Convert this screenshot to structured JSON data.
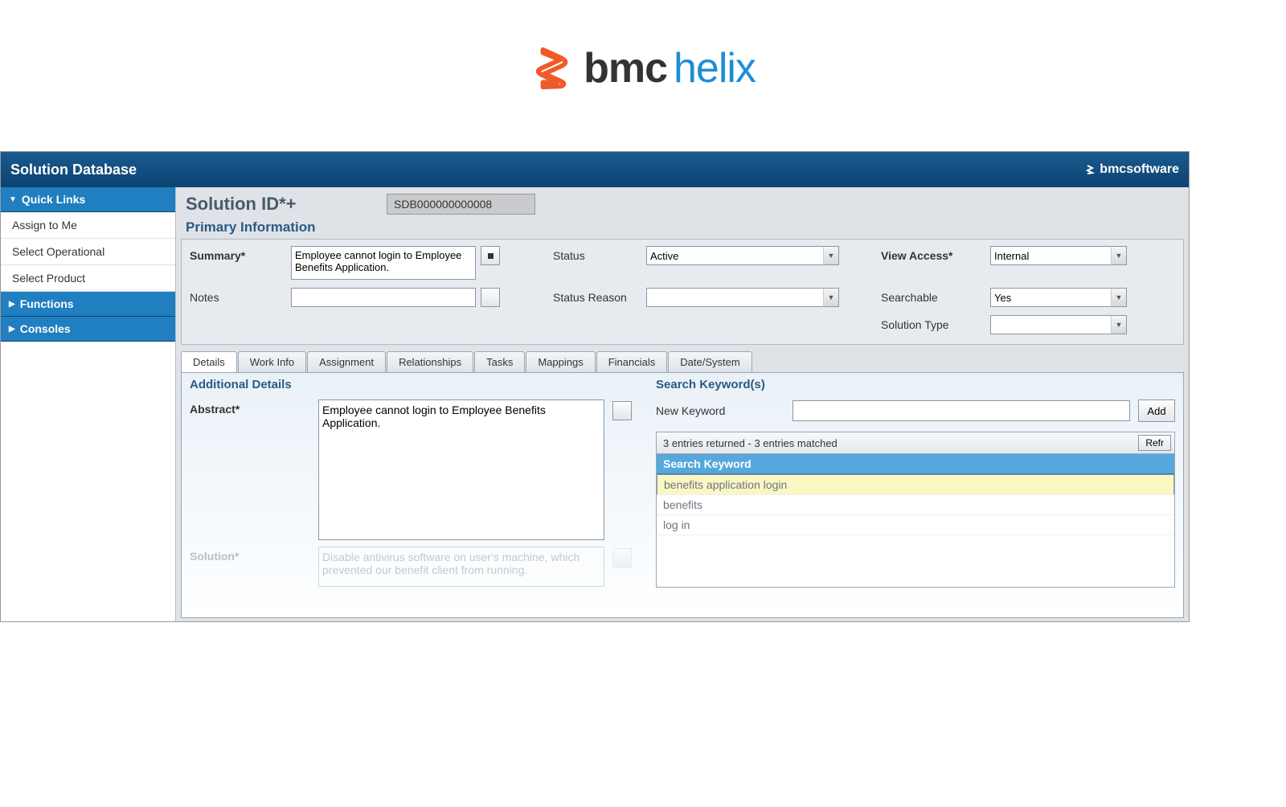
{
  "logo": {
    "bmc": "bmc",
    "helix": "helix"
  },
  "titlebar": {
    "title": "Solution Database",
    "brand": "bmcsoftware"
  },
  "sidebar": {
    "sections": [
      {
        "label": "Quick Links",
        "items": [
          "Assign to Me",
          "Select Operational",
          "Select Product"
        ]
      },
      {
        "label": "Functions",
        "items": []
      },
      {
        "label": "Consoles",
        "items": []
      }
    ]
  },
  "solution_id": {
    "label": "Solution ID*+",
    "value": "SDB000000000008"
  },
  "primary": {
    "title": "Primary Information",
    "summary_label": "Summary*",
    "summary_value": "Employee cannot login to Employee Benefits Application.",
    "notes_label": "Notes",
    "notes_value": "",
    "status_label": "Status",
    "status_value": "Active",
    "status_reason_label": "Status Reason",
    "status_reason_value": "",
    "view_access_label": "View Access*",
    "view_access_value": "Internal",
    "searchable_label": "Searchable",
    "searchable_value": "Yes",
    "solution_type_label": "Solution Type",
    "solution_type_value": ""
  },
  "tabs": [
    "Details",
    "Work Info",
    "Assignment",
    "Relationships",
    "Tasks",
    "Mappings",
    "Financials",
    "Date/System"
  ],
  "details": {
    "title": "Additional Details",
    "abstract_label": "Abstract*",
    "abstract_value": "Employee cannot login to Employee Benefits Application.",
    "solution_label": "Solution*",
    "solution_value": "Disable antivirus software on user's machine, which prevented our benefit client from running."
  },
  "keywords": {
    "title": "Search Keyword(s)",
    "new_label": "New Keyword",
    "new_value": "",
    "add_label": "Add",
    "count_text": "3 entries returned - 3 entries matched",
    "refresh_label": "Refr",
    "header": "Search Keyword",
    "rows": [
      "benefits application login",
      "benefits",
      "log in"
    ]
  }
}
